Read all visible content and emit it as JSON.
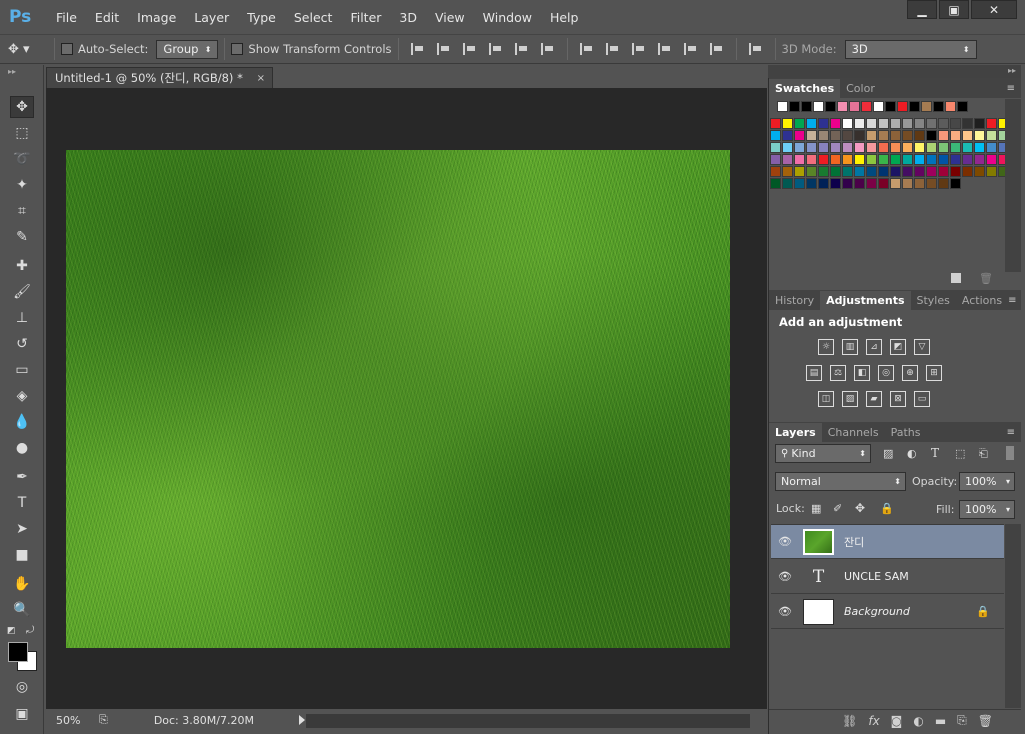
{
  "app": {
    "logo": "Ps"
  },
  "menu": [
    "File",
    "Edit",
    "Image",
    "Layer",
    "Type",
    "Select",
    "Filter",
    "3D",
    "View",
    "Window",
    "Help"
  ],
  "window_buttons": {
    "minimize": "▁",
    "maximize": "▣",
    "close": "✕"
  },
  "options": {
    "auto_select_label": "Auto-Select:",
    "auto_select_value": "Group",
    "show_transform_label": "Show Transform Controls",
    "mode_label": "3D Mode:",
    "mode_value": "3D"
  },
  "document": {
    "tab_title": "Untitled-1 @ 50% (잔디, RGB/8) *",
    "tab_close": "×",
    "zoom": "50%",
    "doc_size": "Doc: 3.80M/7.20M"
  },
  "swatches_panel": {
    "tabs": [
      "Swatches",
      "Color"
    ],
    "recent": [
      "#ffffff",
      "#000000",
      "#000000",
      "#ffffff",
      "#000000",
      "#f48fb1",
      "#e57397",
      "#ef2d3a",
      "#ffffff",
      "#000000",
      "#ed1c24",
      "#000000",
      "#a67c52",
      "#000000",
      "#f7876d",
      "#000000"
    ],
    "grid": [
      [
        "#ed1c24",
        "#fff200",
        "#00a651",
        "#00aeef",
        "#2e3192",
        "#ec008c",
        "#ffffff",
        "#ebebeb",
        "#d7d7d7",
        "#c2c2c2",
        "#adadad",
        "#999999",
        "#858585",
        "#707070",
        "#5c5c5c",
        "#474747",
        "#333333",
        "#1f1f1f",
        "#ed1c24",
        "#fff200",
        "#00a651"
      ],
      [
        "#00aeef",
        "#2e3192",
        "#ec008c",
        "#c7b299",
        "#998675",
        "#736357",
        "#534741",
        "#37302d",
        "#c69c6d",
        "#a67c52",
        "#8c6239",
        "#754c24",
        "#603913",
        "#000000",
        "#f7977a",
        "#f9ad81",
        "#fdc68a",
        "#fff79a",
        "#c4df9b",
        "#a3d39c",
        "#82ca9d"
      ],
      [
        "#7bcdc8",
        "#6ecff6",
        "#7ea7d8",
        "#8493ca",
        "#8882be",
        "#a187be",
        "#bc8dbf",
        "#f49ac2",
        "#f6989d",
        "#f26c4f",
        "#f68e55",
        "#fbaf5c",
        "#fff467",
        "#acd372",
        "#7cc576",
        "#3bb878",
        "#1abbb4",
        "#00bff3",
        "#438ccb",
        "#5574b9",
        "#605ca8"
      ],
      [
        "#855fa8",
        "#a763a8",
        "#f06ea9",
        "#f26d7d",
        "#ed1c24",
        "#f26522",
        "#f7941d",
        "#fff200",
        "#8dc63f",
        "#39b54a",
        "#00a651",
        "#00a99d",
        "#00aeef",
        "#0072bc",
        "#0054a6",
        "#2e3192",
        "#662d91",
        "#92278f",
        "#ec008c",
        "#ed145b",
        "#9e0b0f"
      ],
      [
        "#a0410d",
        "#a3620a",
        "#aba000",
        "#598527",
        "#197b30",
        "#007236",
        "#00746b",
        "#0076a3",
        "#004a80",
        "#003471",
        "#1b1464",
        "#440e62",
        "#630460",
        "#9e005d",
        "#9e0039",
        "#790000",
        "#7b2e00",
        "#7d4900",
        "#827b00",
        "#406618",
        "#005e20"
      ],
      [
        "#005826",
        "#005952",
        "#005b7f",
        "#003663",
        "#002157",
        "#0d004c",
        "#32004b",
        "#4b0049",
        "#7b0046",
        "#7a0026",
        "#c69c6d",
        "#a67c52",
        "#8c6239",
        "#754c24",
        "#603913",
        "#000000"
      ]
    ]
  },
  "adjust_panel": {
    "tabs": [
      "History",
      "Adjustments",
      "Styles",
      "Actions"
    ],
    "title": "Add an adjustment",
    "icons": [
      [
        "brightness-icon",
        "levels-icon",
        "curves-icon",
        "exposure-icon",
        "vibrance-icon"
      ],
      [
        "hue-saturation-icon",
        "color-balance-icon",
        "black-white-icon",
        "photo-filter-icon",
        "channel-mixer-icon",
        "color-lookup-icon"
      ],
      [
        "invert-icon",
        "posterize-icon",
        "threshold-icon",
        "selective-color-icon",
        "gradient-map-icon"
      ]
    ]
  },
  "layers_panel": {
    "tabs": [
      "Layers",
      "Channels",
      "Paths"
    ],
    "filter_value": "Kind",
    "blend_mode": "Normal",
    "opacity_label": "Opacity:",
    "opacity_value": "100%",
    "lock_label": "Lock:",
    "fill_label": "Fill:",
    "fill_value": "100%",
    "layers": [
      {
        "name": "잔디",
        "type": "image",
        "selected": true
      },
      {
        "name": "UNCLE SAM",
        "type": "text",
        "selected": false
      },
      {
        "name": "Background",
        "type": "background",
        "selected": false
      }
    ]
  }
}
